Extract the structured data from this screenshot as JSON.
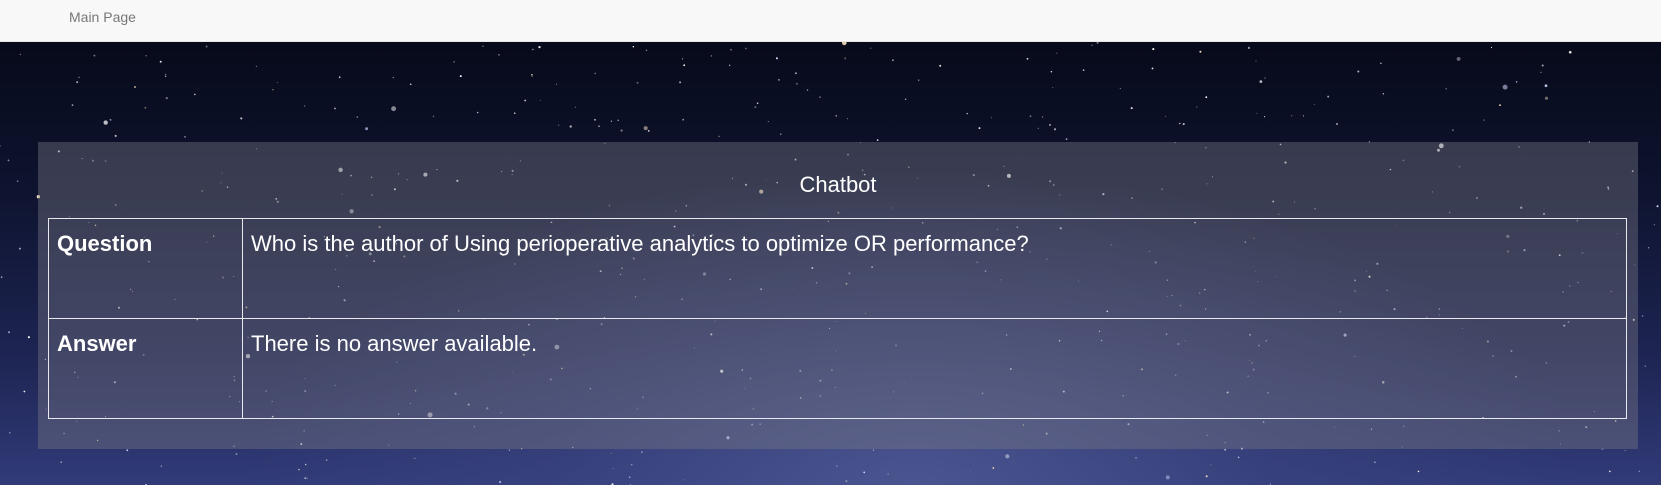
{
  "navbar": {
    "main_page_label": "Main Page"
  },
  "chatbot": {
    "title": "Chatbot",
    "rows": [
      {
        "label": "Question",
        "value": "Who is the author of Using perioperative analytics to optimize OR performance?"
      },
      {
        "label": "Answer",
        "value": "There is no answer available."
      }
    ]
  },
  "colors": {
    "navbar_bg": "#f8f8f8",
    "nav_link": "#777777",
    "panel_text": "#ffffff"
  }
}
